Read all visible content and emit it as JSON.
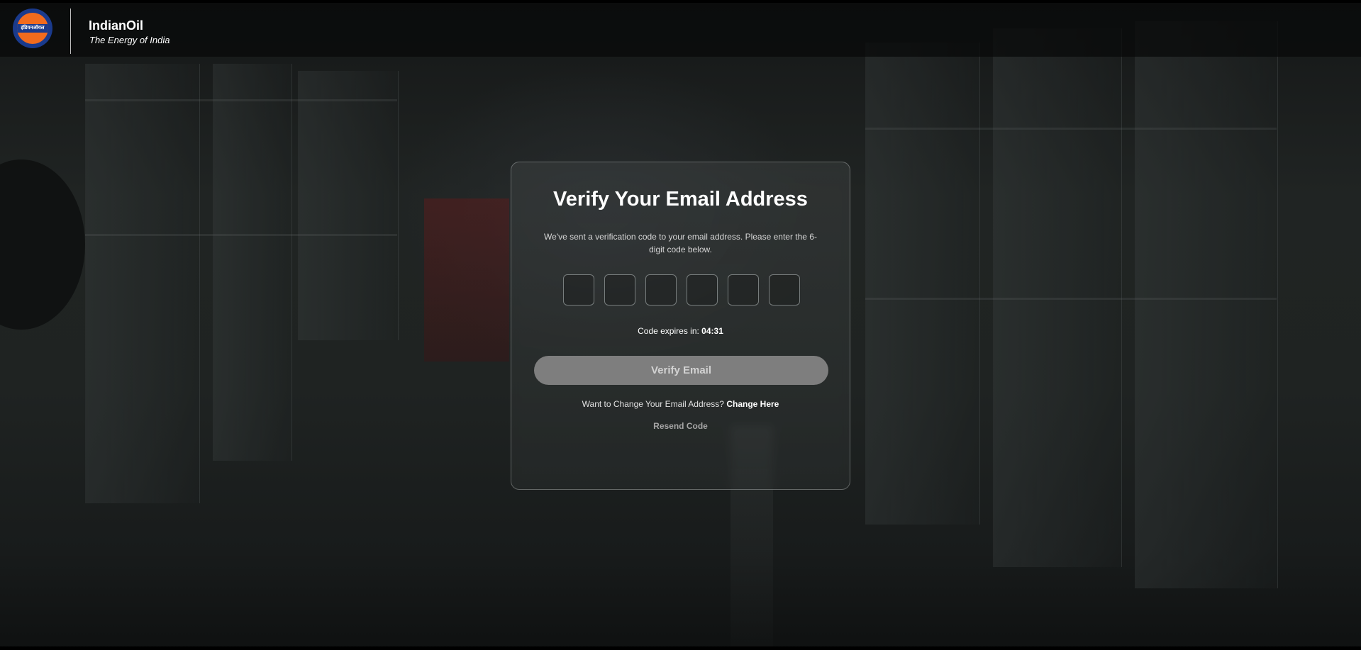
{
  "header": {
    "logo_text": "इंडियनऑयल",
    "brand_name": "IndianOil",
    "tagline": "The Energy of India"
  },
  "card": {
    "title": "Verify Your Email Address",
    "description": "We've sent a verification code to your email address. Please enter the 6-digit code below.",
    "otp_digits": [
      "",
      "",
      "",
      "",
      "",
      ""
    ],
    "expiry_label": "Code expires in:",
    "expiry_time": "04:31",
    "verify_button": "Verify Email",
    "change_prompt": "Want to Change Your Email Address?",
    "change_link": "Change Here",
    "resend_link": "Resend Code"
  },
  "colors": {
    "logo_orange": "#f26b1d",
    "logo_blue": "#1a3a8c",
    "button_disabled": "#7e7e7e"
  }
}
